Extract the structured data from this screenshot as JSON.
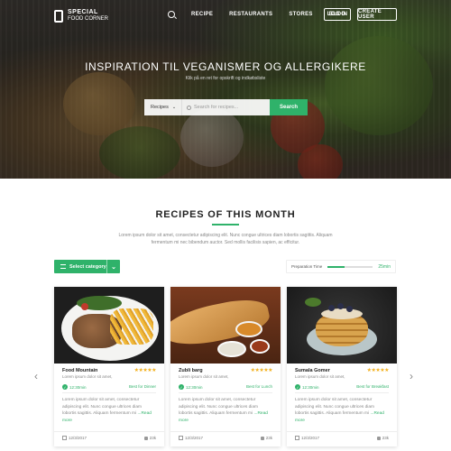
{
  "header": {
    "logo_line1": "SPECIAL",
    "logo_line2": "FOOD CORNER",
    "search_icon": "search-icon",
    "nav": [
      "RECIPE",
      "RESTAURANTS",
      "STORES",
      "BLOG"
    ],
    "login_label": "LOG IN",
    "create_user_label": "CREATE USER"
  },
  "hero": {
    "title": "INSPIRATION TIL VEGANISMER OG ALLERGIKERE",
    "subtitle": "Klik på en ret for opskrift og indkøbsliste",
    "search_category": "Recipes",
    "search_placeholder": "Search for recipes...",
    "search_button": "Search"
  },
  "section": {
    "title": "RECIPES OF THIS MONTH",
    "description": "Lorem ipsum dolor sit amet, consectetur adipiscing elit. Nunc congue ultrices diam lobortis sagittis. Aliquam fermentum mi nec bibendum auctor. Sed mollis facilisis sapien, ac efficitur."
  },
  "filters": {
    "category_button": "Select category",
    "prep_label": "Preparation Time",
    "prep_value": "25min",
    "prep_fraction": 0.37
  },
  "cards": [
    {
      "name": "Food Mountain",
      "stars": "★★★★★",
      "short": "Lorem ipsum dolor sit amet,",
      "time": "12:30min",
      "best": "Best for Dinner",
      "desc": "Lorem ipsum dolor sit amet, consectetur adipiscing elit. Nunc congue ultrices diam lobortis sagittis. Aliquam fermentum mi ",
      "more": "...Read more",
      "date": "12/3/2017",
      "likes": "23k"
    },
    {
      "name": "Zubli barg",
      "stars": "★★★★★",
      "short": "Lorem ipsum dolor sit amet,",
      "time": "12:30min",
      "best": "Best for Lunch",
      "desc": "Lorem ipsum dolor sit amet, consectetur adipiscing elit. Nunc congue ultrices diam lobortis sagittis. Aliquam fermentum mi ",
      "more": "...Read more",
      "date": "12/3/2017",
      "likes": "23k"
    },
    {
      "name": "Sumala Gomer",
      "stars": "★★★★★",
      "short": "Lorem ipsum dolor sit amet,",
      "time": "12:30min",
      "best": "Best for Breakfast",
      "desc": "Lorem ipsum dolor sit amet, consectetur adipiscing elit. Nunc congue ultrices diam lobortis sagittis. Aliquam fermentum mi ",
      "more": "...Read more",
      "date": "12/3/2017",
      "likes": "23k"
    }
  ],
  "nav_arrows": {
    "prev": "‹",
    "next": "›"
  },
  "colors": {
    "accent": "#2fb26a",
    "stars": "#f2b01e"
  }
}
